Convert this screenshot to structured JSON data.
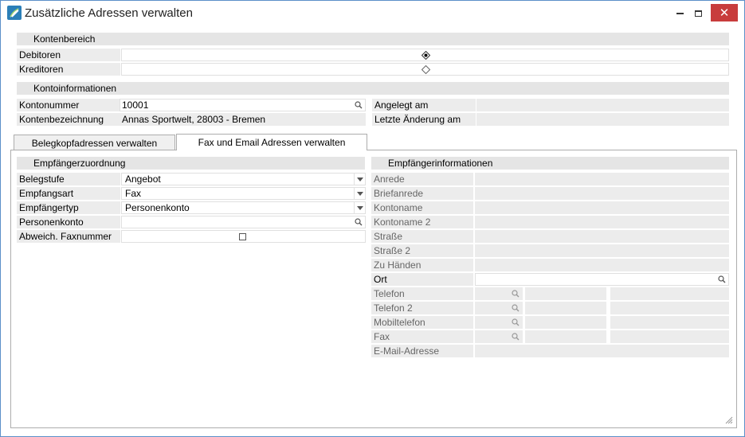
{
  "window": {
    "title": "Zusätzliche Adressen verwalten",
    "close_glyph": "✕"
  },
  "kontenbereich": {
    "header": "Kontenbereich",
    "rows": [
      {
        "label": "Debitoren",
        "selected": true
      },
      {
        "label": "Kreditoren",
        "selected": false
      }
    ]
  },
  "kontoinformationen": {
    "header": "Kontoinformationen",
    "kontonummer_label": "Kontonummer",
    "kontonummer_value": "10001",
    "kontenbezeichnung_label": "Kontenbezeichnung",
    "kontenbezeichnung_value": "Annas Sportwelt, 28003 - Bremen",
    "angelegt_label": "Angelegt am",
    "angelegt_value": "",
    "letzte_label": "Letzte Änderung am",
    "letzte_value": ""
  },
  "tabs": [
    {
      "label": "Belegkopfadressen verwalten",
      "active": false
    },
    {
      "label": "Fax und Email Adressen verwalten",
      "active": true
    }
  ],
  "empfaengerzuordnung": {
    "header": "Empfängerzuordnung",
    "belegstufe_label": "Belegstufe",
    "belegstufe_value": "Angebot",
    "empfangsart_label": "Empfangsart",
    "empfangsart_value": "Fax",
    "empfaengertyp_label": "Empfängertyp",
    "empfaengertyp_value": "Personenkonto",
    "personenkonto_label": "Personenkonto",
    "personenkonto_value": "",
    "faxnummer_label": "Abweich. Faxnummer",
    "faxnummer_checked": false
  },
  "empfaengerinformationen": {
    "header": "Empfängerinformationen",
    "anrede": "Anrede",
    "briefanrede": "Briefanrede",
    "kontoname": "Kontoname",
    "kontoname2": "Kontoname 2",
    "strasse": "Straße",
    "strasse2": "Straße 2",
    "zu_haenden": "Zu Händen",
    "ort": "Ort",
    "telefon": "Telefon",
    "telefon2": "Telefon 2",
    "mobiltelefon": "Mobiltelefon",
    "fax": "Fax",
    "email": "E-Mail-Adresse"
  },
  "colors": {
    "accent": "#5b8fc9",
    "close": "#c83c3c",
    "header_bg": "#e5e5e5"
  }
}
